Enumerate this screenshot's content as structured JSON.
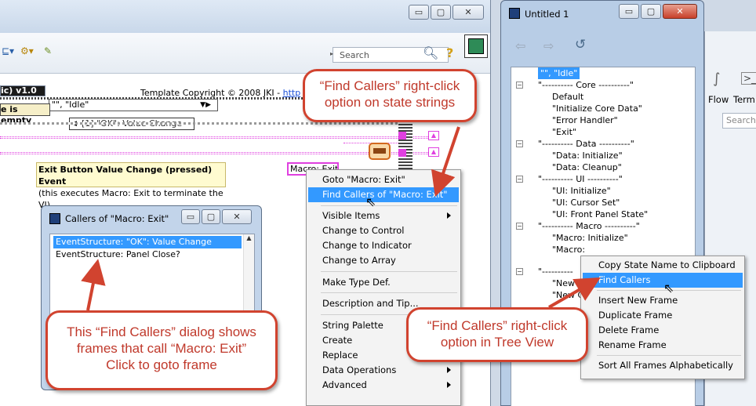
{
  "block_diagram": {
    "search_placeholder": "Search",
    "help_glyph": "?",
    "header_left": "ic) v1.0",
    "copyright_prefix": "Template Copyright © 2008 JKI - ",
    "copyright_link": "http",
    "case_selector_idle": "\"\", \"Idle\"",
    "queue_empty": "e is empty",
    "event_selector": "[1] \"OK\": Value Change",
    "event_comment_bold": "Exit Button Value Change (pressed) Event",
    "event_comment_note": "(this executes Macro: Exit to terminate the VI)",
    "macro_constant": "Macro: Exit"
  },
  "context_menu": {
    "items": [
      {
        "label": "Goto \"Macro: Exit\"",
        "highlighted": false,
        "submenu": false
      },
      {
        "label": "Find Callers of \"Macro: Exit\"",
        "highlighted": true,
        "submenu": false
      },
      {
        "label": "Visible Items",
        "highlighted": false,
        "submenu": true
      },
      {
        "label": "Change to Control",
        "highlighted": false,
        "submenu": false
      },
      {
        "label": "Change to Indicator",
        "highlighted": false,
        "submenu": false
      },
      {
        "label": "Change to Array",
        "highlighted": false,
        "submenu": false
      },
      {
        "label": "Make Type Def.",
        "highlighted": false,
        "submenu": false
      },
      {
        "label": "Description and Tip...",
        "highlighted": false,
        "submenu": false
      },
      {
        "label": "String Palette",
        "highlighted": false,
        "submenu": false
      },
      {
        "label": "Create",
        "highlighted": false,
        "submenu": false
      },
      {
        "label": "Replace",
        "highlighted": false,
        "submenu": false
      },
      {
        "label": "Data Operations",
        "highlighted": false,
        "submenu": true
      },
      {
        "label": "Advanced",
        "highlighted": false,
        "submenu": true
      }
    ]
  },
  "callers_dialog": {
    "title": "Callers of \"Macro: Exit\"",
    "rows": [
      {
        "label": "EventStructure:  \"OK\": Value Change",
        "selected": true
      },
      {
        "label": "EventStructure:  Panel Close?",
        "selected": false
      }
    ]
  },
  "callouts": {
    "state_strings": "“Find Callers” right-click option on state strings",
    "dialog": "This “Find Callers” dialog shows frames that call “Macro: Exit” Click to goto frame",
    "tree_view": "“Find Callers” right-click option in Tree View"
  },
  "tree_window": {
    "title": "Untitled 1",
    "rows": [
      {
        "label": "\"\", \"Idle\"",
        "level": 1,
        "toggle": "",
        "selected": true
      },
      {
        "label": "\"---------- Core ----------\"",
        "level": 1,
        "toggle": "−",
        "selected": false
      },
      {
        "label": "Default",
        "level": 2,
        "toggle": "",
        "selected": false
      },
      {
        "label": "\"Initialize Core Data\"",
        "level": 2,
        "toggle": "",
        "selected": false
      },
      {
        "label": "\"Error Handler\"",
        "level": 2,
        "toggle": "",
        "selected": false
      },
      {
        "label": "\"Exit\"",
        "level": 2,
        "toggle": "",
        "selected": false
      },
      {
        "label": "\"---------- Data ----------\"",
        "level": 1,
        "toggle": "−",
        "selected": false
      },
      {
        "label": "\"Data: Initialize\"",
        "level": 2,
        "toggle": "",
        "selected": false
      },
      {
        "label": "\"Data: Cleanup\"",
        "level": 2,
        "toggle": "",
        "selected": false
      },
      {
        "label": "\"---------- UI ----------\"",
        "level": 1,
        "toggle": "−",
        "selected": false
      },
      {
        "label": "\"UI: Initialize\"",
        "level": 2,
        "toggle": "",
        "selected": false
      },
      {
        "label": "\"UI: Cursor Set\"",
        "level": 2,
        "toggle": "",
        "selected": false
      },
      {
        "label": "\"UI: Front Panel State\"",
        "level": 2,
        "toggle": "",
        "selected": false
      },
      {
        "label": "\"---------- Macro ----------\"",
        "level": 1,
        "toggle": "−",
        "selected": false
      },
      {
        "label": "\"Macro: Initialize\"",
        "level": 2,
        "toggle": "",
        "selected": false
      },
      {
        "label": "\"Macro: Exit\"",
        "level": 2,
        "toggle": "",
        "selected": false
      },
      {
        "label": "\"----------",
        "level": 1,
        "toggle": "−",
        "selected": false
      },
      {
        "label": "\"New C",
        "level": 2,
        "toggle": "",
        "selected": false
      },
      {
        "label": "\"New C",
        "level": 2,
        "toggle": "",
        "selected": false
      }
    ]
  },
  "tree_menu": {
    "items": [
      {
        "label": "Copy State Name to Clipboard",
        "highlighted": false
      },
      {
        "label": "Find Callers",
        "highlighted": true
      },
      {
        "label": "Insert New Frame",
        "highlighted": false
      },
      {
        "label": "Duplicate Frame",
        "highlighted": false
      },
      {
        "label": "Delete Frame",
        "highlighted": false
      },
      {
        "label": "Rename Frame",
        "highlighted": false
      },
      {
        "label": "Sort All Frames Alphabetically",
        "highlighted": false
      }
    ]
  },
  "third_window": {
    "tab_flow": "Flow",
    "tab_term": "Term",
    "search_placeholder": "Search"
  },
  "colors": {
    "callout_red": "#d1432f",
    "menu_highlight": "#3399ff",
    "wire_pink": "#e040e0"
  }
}
